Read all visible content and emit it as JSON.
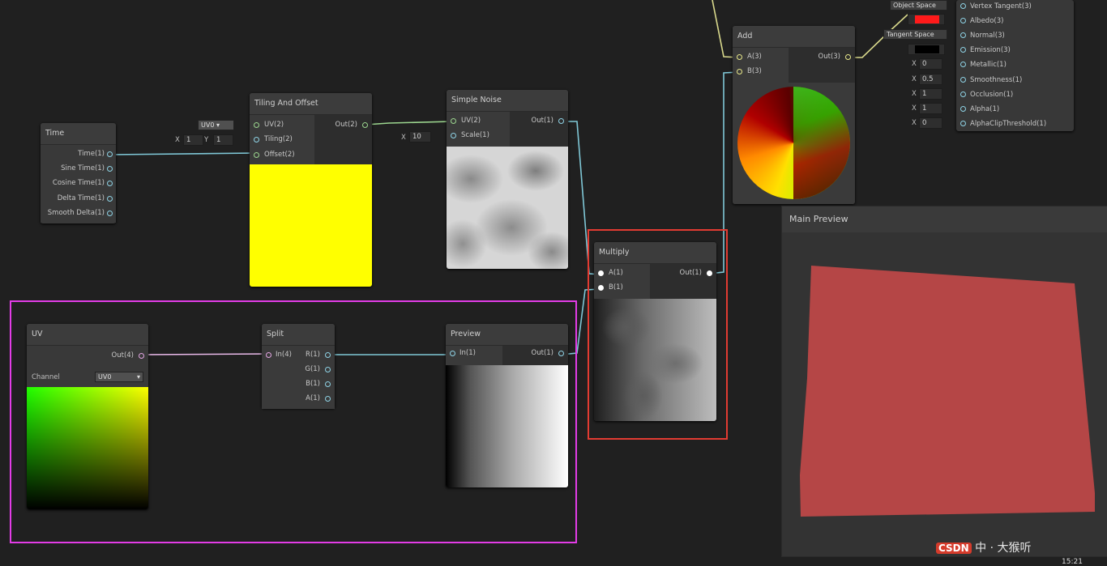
{
  "graph": {
    "time": {
      "title": "Time",
      "outputs": [
        "Time(1)",
        "Sine Time(1)",
        "Cosine Time(1)",
        "Delta Time(1)",
        "Smooth Delta(1)"
      ]
    },
    "tiling": {
      "title": "Tiling And Offset",
      "inputs": [
        "UV(2)",
        "Tiling(2)",
        "Offset(2)"
      ],
      "output": "Out(2)",
      "uv_select": "UV0",
      "tiling_x_label": "X",
      "tiling_x": "1",
      "tiling_y_label": "Y",
      "tiling_y": "1",
      "preview_color": "#ffff00"
    },
    "noise": {
      "title": "Simple Noise",
      "inputs": [
        "UV(2)",
        "Scale(1)"
      ],
      "output": "Out(1)",
      "scale_label": "X",
      "scale": "10"
    },
    "multiply": {
      "title": "Multiply",
      "inputs": [
        "A(1)",
        "B(1)"
      ],
      "output": "Out(1)"
    },
    "add": {
      "title": "Add",
      "inputs": [
        "A(3)",
        "B(3)"
      ],
      "output": "Out(3)"
    },
    "uv": {
      "title": "UV",
      "output": "Out(4)",
      "channel_label": "Channel",
      "channel": "UV0"
    },
    "split": {
      "title": "Split",
      "input": "In(4)",
      "outputs": [
        "R(1)",
        "G(1)",
        "B(1)",
        "A(1)"
      ]
    },
    "preview": {
      "title": "Preview",
      "input": "In(1)",
      "output": "Out(1)"
    },
    "master": {
      "space1": "Object Space",
      "space2": "Tangent Space",
      "ports": [
        "Vertex Tangent(3)",
        "Albedo(3)",
        "Normal(3)",
        "Emission(3)",
        "Metallic(1)",
        "Smoothness(1)",
        "Occlusion(1)",
        "Alpha(1)",
        "AlphaClipThreshold(1)"
      ],
      "x_label": "X",
      "metallic": "0",
      "smoothness": "0.5",
      "occlusion": "1",
      "alpha": "1",
      "clip": "0",
      "albedo_color": "#ff1a1a",
      "emission_color": "#000000"
    },
    "main_preview": {
      "title": "Main Preview"
    }
  },
  "colors": {
    "highlight_red": "#e23b32",
    "highlight_magenta": "#e23ce6",
    "wire_blue": "#7fc7d6",
    "wire_yellow": "#d9d98c",
    "wire_pink": "#e9b9e9"
  },
  "watermark": {
    "brand": "CSDN",
    "text": "中 · 大猴听",
    "clock": "15:21"
  }
}
